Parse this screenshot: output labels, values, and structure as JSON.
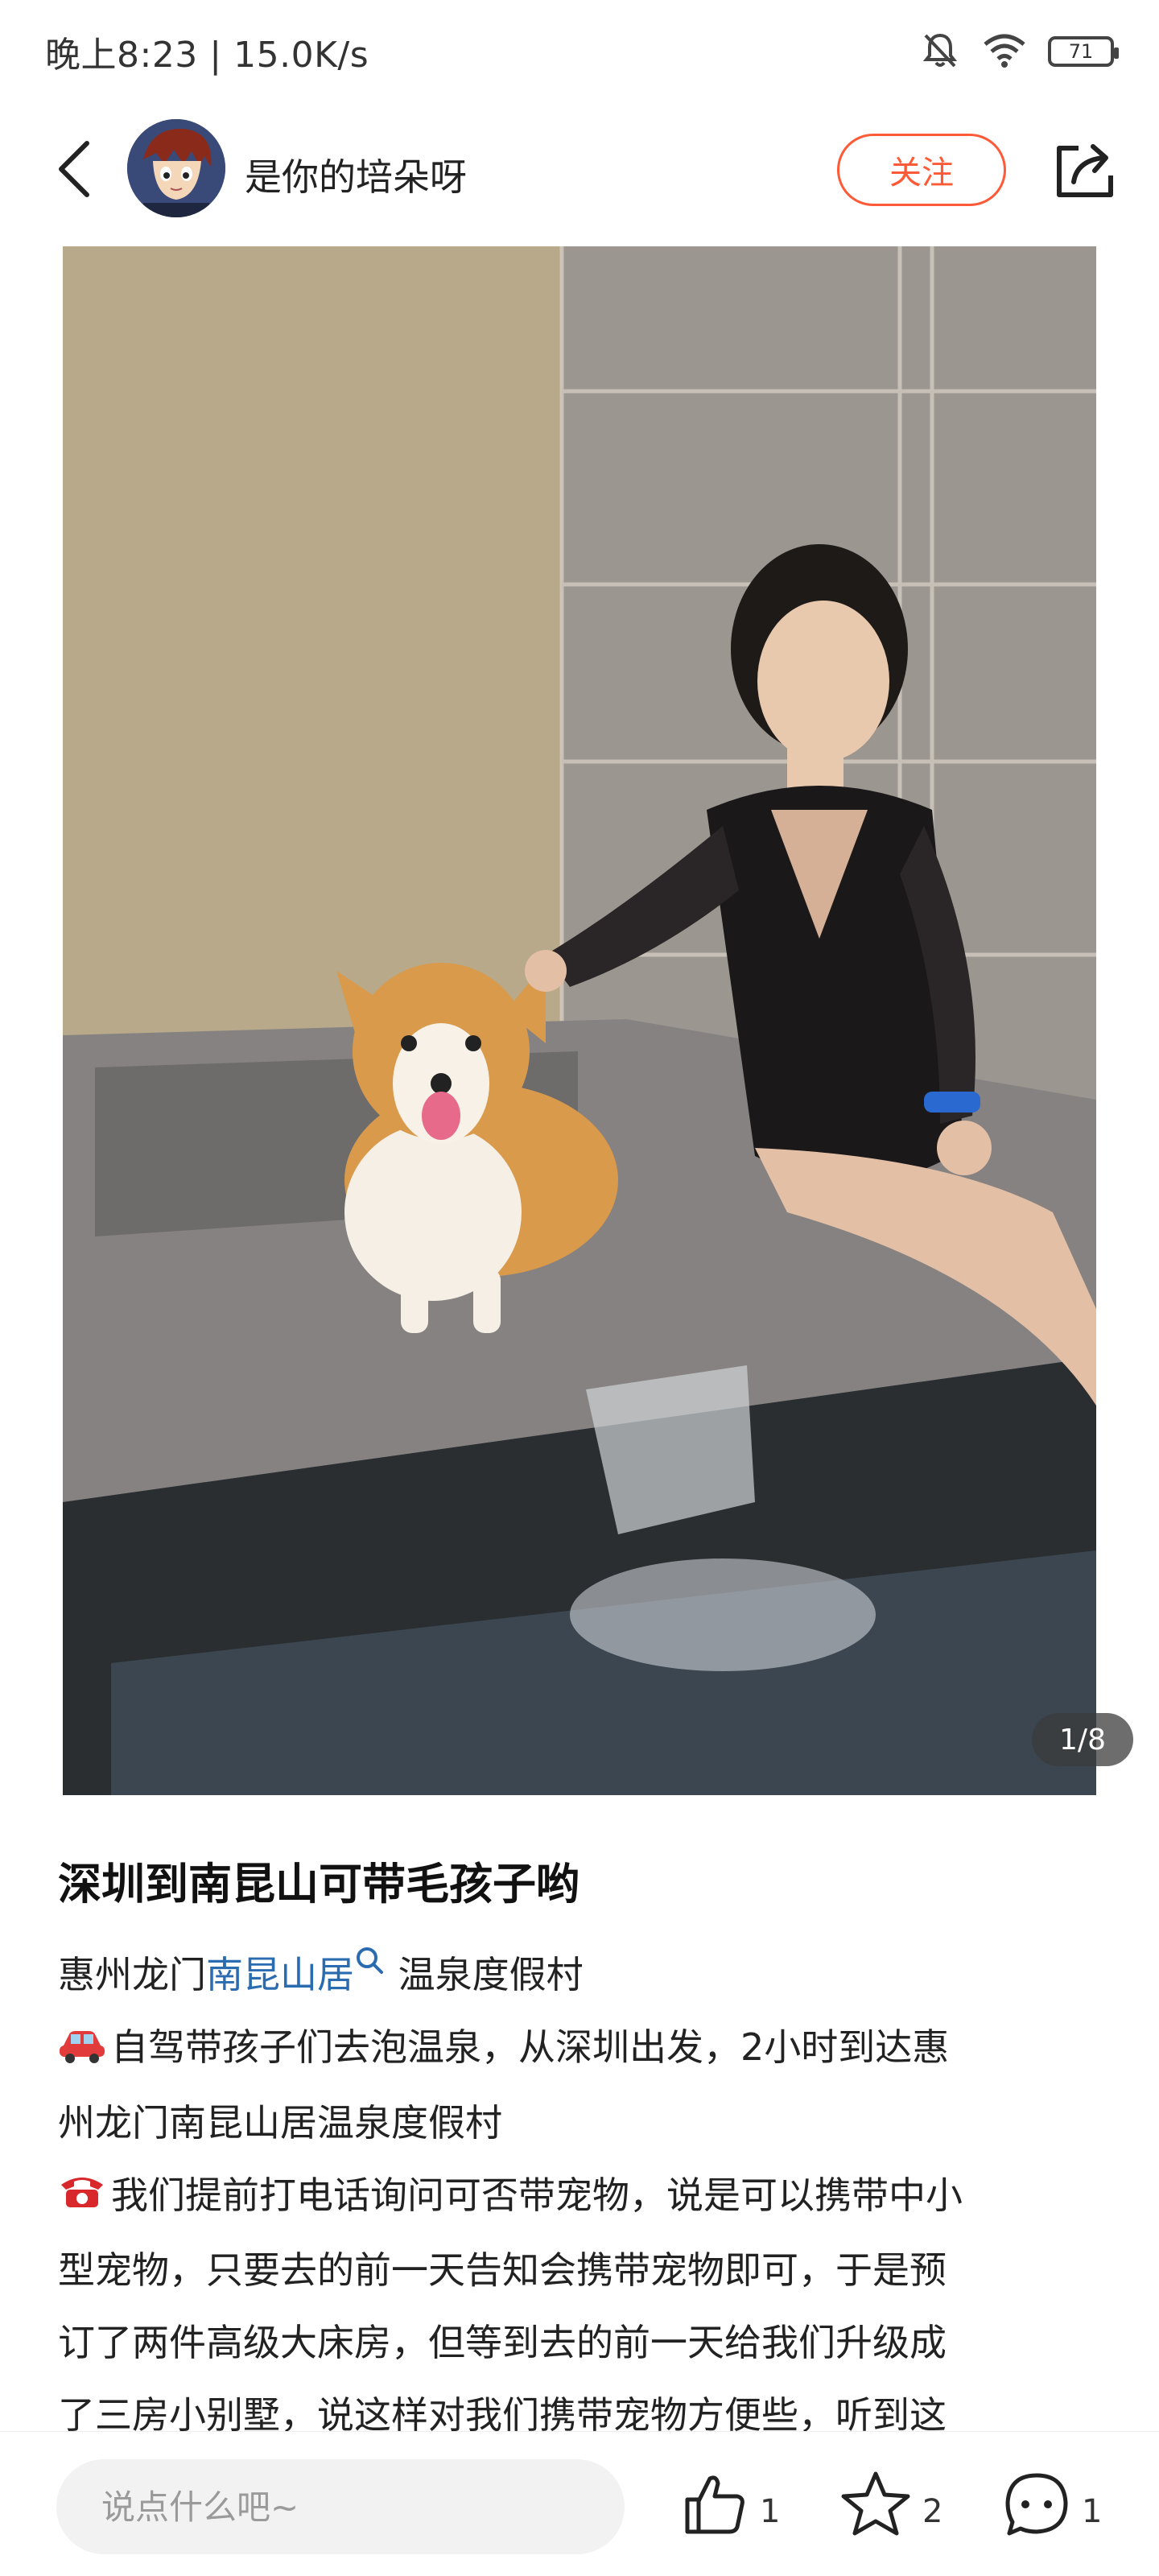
{
  "status_bar": {
    "time_speed": "晚上8:23 | 15.0K/s",
    "battery": "71",
    "icons": [
      "mute-bell-icon",
      "wifi-icon",
      "battery-icon"
    ]
  },
  "header": {
    "author_name": "是你的培朵呀",
    "follow_label": "关注",
    "icons": [
      "back-arrow-icon",
      "share-icon"
    ]
  },
  "photo": {
    "page_indicator": "1/8"
  },
  "post": {
    "title": "深圳到南昆山可带毛孩子哟",
    "location_prefix": "惠州龙门",
    "location_link": "南昆山居",
    "location_suffix": " 温泉度假村",
    "lines": [
      {
        "emoji": "car-emoji",
        "text": "自驾带孩子们去泡温泉，从深圳出发，2小时到达惠"
      },
      {
        "emoji": "",
        "text": "州龙门南昆山居温泉度假村"
      },
      {
        "emoji": "phone-emoji",
        "text": "我们提前打电话询问可否带宠物，说是可以携带中小"
      },
      {
        "emoji": "",
        "text": "型宠物，只要去的前一天告知会携带宠物即可，于是预"
      },
      {
        "emoji": "",
        "text": "订了两件高级大床房，但等到去的前一天给我们升级成"
      },
      {
        "emoji": "",
        "text": "了三房小别墅，说这样对我们携带宠物方便些，听到这"
      }
    ]
  },
  "bottom_bar": {
    "comment_placeholder": "说点什么吧~",
    "like_count": "1",
    "star_count": "2",
    "comment_count": "1"
  },
  "colors": {
    "accent": "#ff5a37",
    "link": "#2b6cb0"
  }
}
